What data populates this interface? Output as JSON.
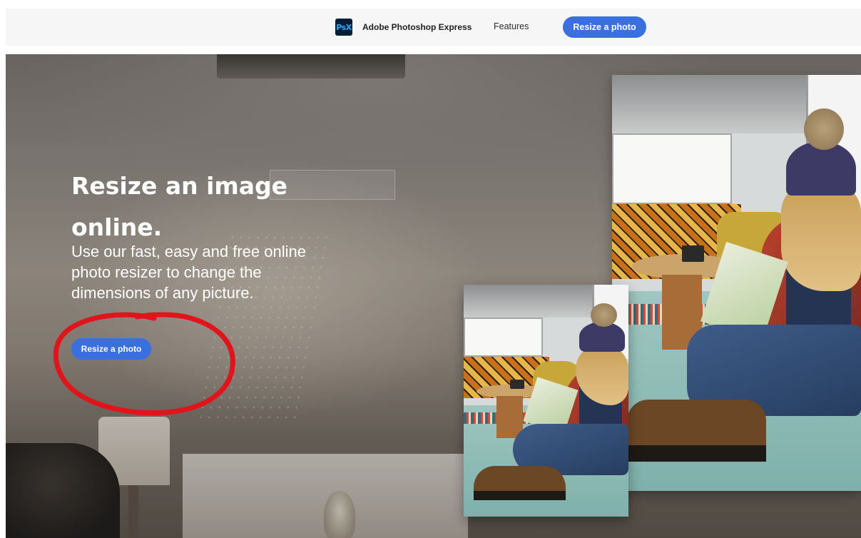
{
  "nav": {
    "logo_text": "PsX",
    "brand": "Adobe Photoshop Express",
    "features": "Features",
    "cta": "Resize a photo"
  },
  "hero": {
    "title": "Resize an image online.",
    "subtitle": "Use our fast, easy and free online photo resizer to change the dimensions of any picture.",
    "cta": "Resize a photo"
  },
  "colors": {
    "accent": "#3a6fe0",
    "annotation": "#e0141a",
    "logo_bg": "#001e36",
    "logo_fg": "#31a8ff"
  },
  "icons": [
    "psx-logo-icon"
  ]
}
